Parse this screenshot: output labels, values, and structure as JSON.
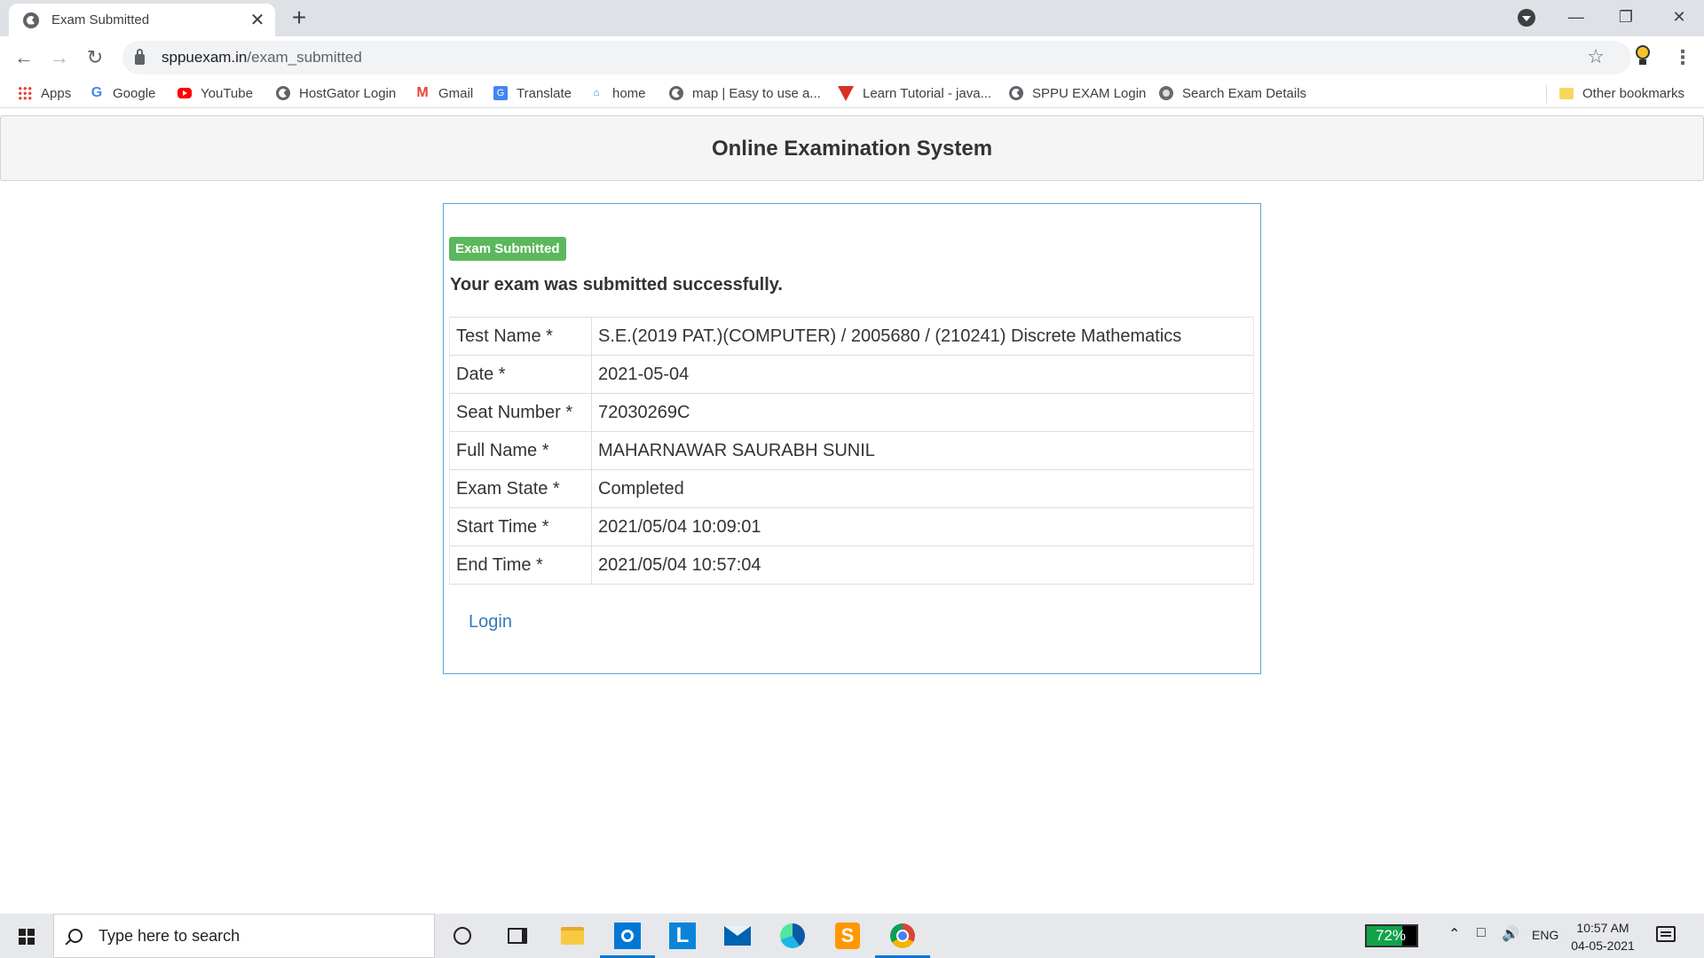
{
  "browser": {
    "tab_title": "Exam Submitted",
    "tab_close": "✕",
    "new_tab": "+",
    "url_host": "sppuexam.in",
    "url_path": "/exam_submitted",
    "bookmarks": [
      {
        "label": "Apps",
        "icon": "apps-icon"
      },
      {
        "label": "Google",
        "icon": "google-icon"
      },
      {
        "label": "YouTube",
        "icon": "youtube-icon"
      },
      {
        "label": "HostGator Login",
        "icon": "globe-icon"
      },
      {
        "label": "Gmail",
        "icon": "gmail-icon"
      },
      {
        "label": "Translate",
        "icon": "translate-icon"
      },
      {
        "label": "home",
        "icon": "home-icon"
      },
      {
        "label": "map | Easy to use a...",
        "icon": "globe-icon"
      },
      {
        "label": "Learn Tutorial - java...",
        "icon": "tutorial-icon"
      },
      {
        "label": "SPPU EXAM Login",
        "icon": "sppu-icon"
      },
      {
        "label": "Search Exam Details",
        "icon": "sppu-icon"
      }
    ],
    "other_bookmarks": "Other bookmarks"
  },
  "page": {
    "site_title": "Online Examination System",
    "badge": "Exam Submitted",
    "message": "Your exam was submitted successfully.",
    "details": [
      {
        "label": "Test Name *",
        "value": "S.E.(2019 PAT.)(COMPUTER) / 2005680 / (210241) Discrete Mathematics"
      },
      {
        "label": "Date *",
        "value": "2021-05-04"
      },
      {
        "label": "Seat Number *",
        "value": "72030269C"
      },
      {
        "label": "Full Name *",
        "value": "MAHARNAWAR SAURABH SUNIL"
      },
      {
        "label": "Exam State *",
        "value": "Completed"
      },
      {
        "label": "Start Time *",
        "value": "2021/05/04 10:09:01"
      },
      {
        "label": "End Time *",
        "value": "2021/05/04 10:57:04"
      }
    ],
    "login_link": "Login"
  },
  "colors": {
    "badge_bg": "#5cb85c",
    "link": "#337ab7",
    "panel_border": "#5aa7d6"
  },
  "taskbar": {
    "search_placeholder": "Type here to search",
    "battery_text": "72%",
    "battery_level": 0.72,
    "language": "ENG",
    "time": "10:57 AM",
    "date": "04-05-2021"
  }
}
